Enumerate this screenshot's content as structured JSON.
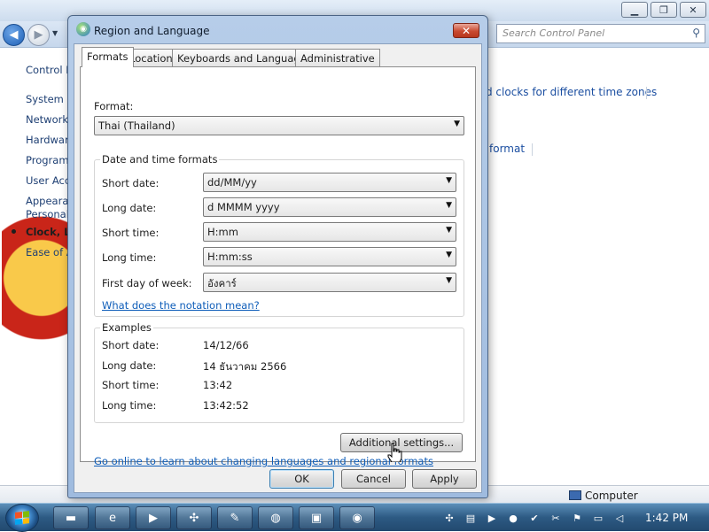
{
  "control_panel": {
    "search_placeholder": "Search Control Panel",
    "sidebar": [
      "Control Panel Home",
      "System and Security",
      "Network and Internet",
      "Hardware and Sound",
      "Programs",
      "User Accounts",
      "Appearance and",
      "Personalization",
      "Clock, Language, and Region",
      "Ease of Access"
    ],
    "main_links": [
      "Add clocks for different time zones",
      "Change the date, time, or number format"
    ],
    "main_link_visible": [
      "d clocks for different time zones",
      "format"
    ],
    "status_text": "Computer"
  },
  "dialog": {
    "title": "Region and Language",
    "close_label": "✕",
    "tabs": [
      "Formats",
      "Location",
      "Keyboards and Languages",
      "Administrative"
    ],
    "format_label": "Format:",
    "format_value": "Thai (Thailand)",
    "date_time_group": "Date and time formats",
    "fields": [
      {
        "label": "Short date:",
        "value": "dd/MM/yy"
      },
      {
        "label": "Long date:",
        "value": "d MMMM yyyy"
      },
      {
        "label": "Short time:",
        "value": "H:mm"
      },
      {
        "label": "Long time:",
        "value": "H:mm:ss"
      },
      {
        "label": "First day of week:",
        "value": "อังคาร์"
      }
    ],
    "notation_link": "What does the notation mean?",
    "examples_group": "Examples",
    "examples": [
      {
        "label": "Short date:",
        "value": "14/12/66"
      },
      {
        "label": "Long date:",
        "value": "14 ธันวาคม 2566"
      },
      {
        "label": "Short time:",
        "value": "13:42"
      },
      {
        "label": "Long time:",
        "value": "13:42:52"
      }
    ],
    "additional_settings": "Additional settings...",
    "online_link": "Go online to learn about changing languages and regional formats",
    "buttons": {
      "ok": "OK",
      "cancel": "Cancel",
      "apply": "Apply"
    }
  },
  "taskbar": {
    "clock": "1:42 PM"
  },
  "colors": {
    "link": "#0e5db9",
    "taskbar": "#2d5a83",
    "close_button": "#c94a30"
  }
}
